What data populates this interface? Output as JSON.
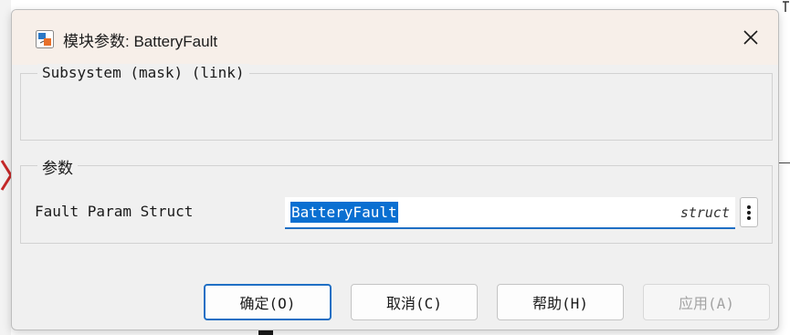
{
  "dialog": {
    "title": "模块参数: BatteryFault",
    "app_icon": "simulink-block-icon",
    "close_icon": "close-icon"
  },
  "description_group": {
    "legend": "Subsystem (mask) (link)"
  },
  "parameters_group": {
    "legend": "参数",
    "fields": [
      {
        "label": "Fault Param Struct",
        "value": "BatteryFault",
        "type_tag": "struct",
        "more_icon": "vertical-ellipsis-icon"
      }
    ]
  },
  "buttons": {
    "ok": "确定(O)",
    "cancel": "取消(C)",
    "help": "帮助(H)",
    "apply": "应用(A)"
  },
  "colors": {
    "accent": "#1f6fc4",
    "selection": "#0a6fd1",
    "titlebar": "#f7efe9",
    "dialog_bg": "#f0f0f0"
  }
}
